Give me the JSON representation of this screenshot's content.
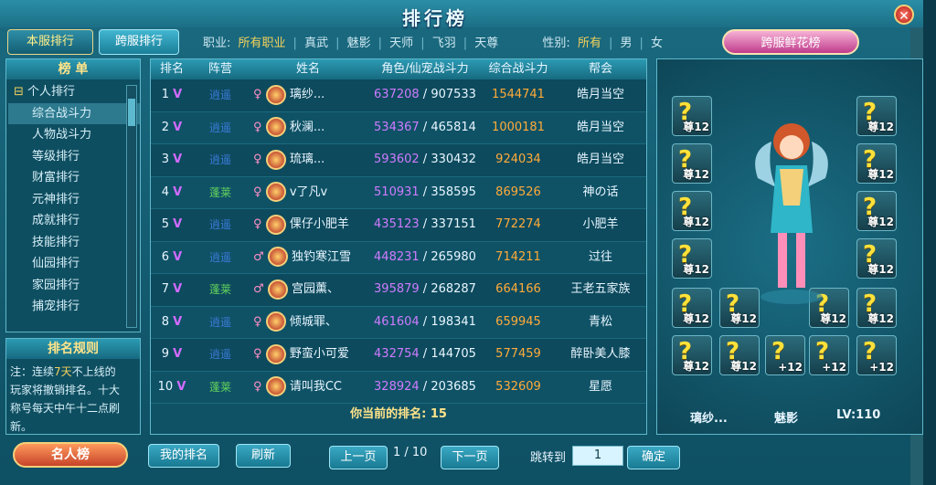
{
  "window": {
    "title": "排行榜",
    "close": "✕"
  },
  "tabs": {
    "local": "本服排行",
    "cross": "跨服排行"
  },
  "filters": {
    "job_label": "职业:",
    "jobs": [
      "所有职业",
      "真武",
      "魅影",
      "天师",
      "飞羽",
      "天尊"
    ],
    "gender_label": "性别:",
    "genders": [
      "所有",
      "男",
      "女"
    ]
  },
  "flower_button": "跨服鲜花榜",
  "left_panel": {
    "title": "榜 单",
    "category": "个人排行",
    "items": [
      "综合战斗力",
      "人物战斗力",
      "等级排行",
      "财富排行",
      "元神排行",
      "成就排行",
      "技能排行",
      "仙园排行",
      "家园排行",
      "捕宠排行"
    ]
  },
  "rules": {
    "title": "排名规则",
    "text_a": "注：连续",
    "days": "7天",
    "text_b": "不上线的玩家将撤销排名。十大称号每天中午十二点刷新。"
  },
  "famous_button": "名人榜",
  "table": {
    "headers": [
      "排名",
      "阵营",
      "姓名",
      "角色/仙宠战斗力",
      "综合战斗力",
      "帮会"
    ],
    "rows": [
      {
        "rank": "1",
        "faction": "逍遥",
        "gender": "♀",
        "name": "璃纱...",
        "role_power": "637208",
        "pet_power": "907533",
        "total": "1544741",
        "guild": "皓月当空"
      },
      {
        "rank": "2",
        "faction": "逍遥",
        "gender": "♀",
        "name": "秋澜...",
        "role_power": "534367",
        "pet_power": "465814",
        "total": "1000181",
        "guild": "皓月当空"
      },
      {
        "rank": "3",
        "faction": "逍遥",
        "gender": "♀",
        "name": "琉璃...",
        "role_power": "593602",
        "pet_power": "330432",
        "total": "924034",
        "guild": "皓月当空"
      },
      {
        "rank": "4",
        "faction": "蓬莱",
        "gender": "♀",
        "name": "v了凡v",
        "role_power": "510931",
        "pet_power": "358595",
        "total": "869526",
        "guild": "神の话"
      },
      {
        "rank": "5",
        "faction": "逍遥",
        "gender": "♀",
        "name": "倮仔小肥羊",
        "role_power": "435123",
        "pet_power": "337151",
        "total": "772274",
        "guild": "小肥羊"
      },
      {
        "rank": "6",
        "faction": "逍遥",
        "gender": "♂",
        "name": "独钓寒江雪",
        "role_power": "448231",
        "pet_power": "265980",
        "total": "714211",
        "guild": "过往"
      },
      {
        "rank": "7",
        "faction": "蓬莱",
        "gender": "♂",
        "name": "宫园薰、",
        "role_power": "395879",
        "pet_power": "268287",
        "total": "664166",
        "guild": "王老五家族"
      },
      {
        "rank": "8",
        "faction": "逍遥",
        "gender": "♀",
        "name": "倾城罪、",
        "role_power": "461604",
        "pet_power": "198341",
        "total": "659945",
        "guild": "青松"
      },
      {
        "rank": "9",
        "faction": "逍遥",
        "gender": "♀",
        "name": "野蛮小可爱",
        "role_power": "432754",
        "pet_power": "144705",
        "total": "577459",
        "guild": "醉卧美人膝"
      },
      {
        "rank": "10",
        "faction": "蓬莱",
        "gender": "♀",
        "name": "请叫我CC",
        "role_power": "328924",
        "pet_power": "203685",
        "total": "532609",
        "guild": "星愿"
      }
    ],
    "current_rank_label": "你当前的排名:",
    "current_rank": "15"
  },
  "equipment": {
    "slot_level": "尊12",
    "slot_bonus": "+12",
    "player_name": "璃纱...",
    "player_class": "魅影",
    "player_level": "LV:110"
  },
  "bottom": {
    "my_rank": "我的排名",
    "refresh": "刷新",
    "prev": "上一页",
    "page": "1 / 10",
    "next": "下一页",
    "jump_label": "跳转到",
    "jump_value": "1",
    "confirm": "确定"
  }
}
